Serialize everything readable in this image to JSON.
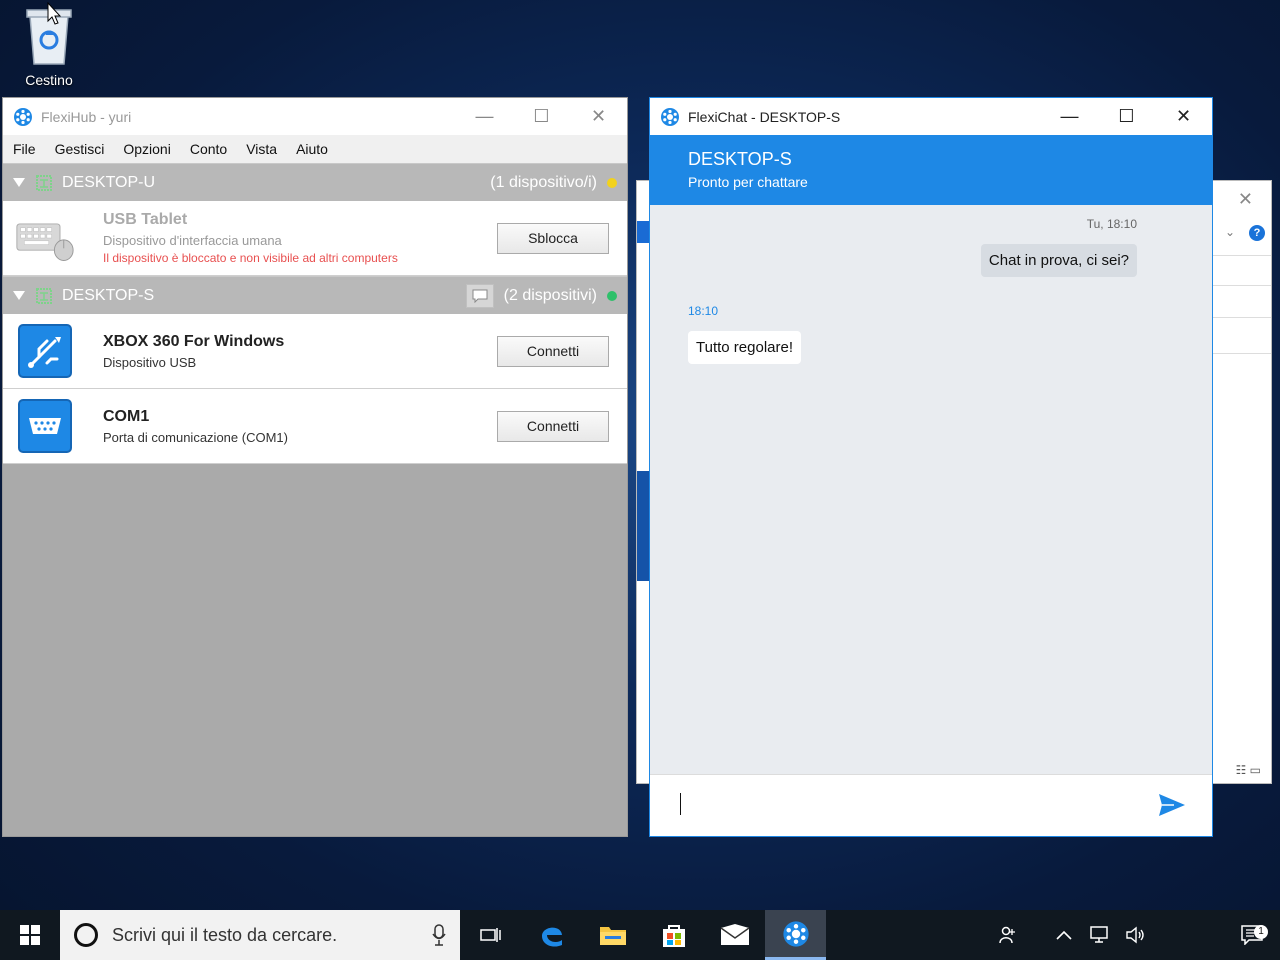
{
  "desktop": {
    "recycle_bin_label": "Cestino"
  },
  "flexihub": {
    "title": "FlexiHub - yuri",
    "menu": [
      "File",
      "Gestisci",
      "Opzioni",
      "Conto",
      "Vista",
      "Aiuto"
    ],
    "groups": [
      {
        "name": "DESKTOP-U",
        "count": "(1 dispositivo/i)",
        "status_color": "#f2d21c",
        "devices": [
          {
            "name": "USB Tablet",
            "type": "Dispositivo d'interfaccia umana",
            "warning": "Il dispositivo è bloccato e non visibile ad altri computers",
            "button": "Sblocca",
            "icon": "keyboard-mouse-icon"
          }
        ]
      },
      {
        "name": "DESKTOP-S",
        "count": "(2 dispositivi)",
        "status_color": "#2ec06a",
        "devices": [
          {
            "name": "XBOX 360 For Windows",
            "type": "Dispositivo USB",
            "button": "Connetti",
            "icon": "usb-icon"
          },
          {
            "name": "COM1",
            "type": "Porta di comunicazione (COM1)",
            "button": "Connetti",
            "icon": "serial-port-icon"
          }
        ]
      }
    ]
  },
  "flexichat": {
    "title": "FlexiChat - DESKTOP-S",
    "header_name": "DESKTOP-S",
    "header_status": "Pronto per chattare",
    "messages": [
      {
        "time": "Tu, 18:10",
        "text": "Chat in prova, ci sei?",
        "direction": "out"
      },
      {
        "time": "18:10",
        "text": "Tutto regolare!",
        "direction": "in"
      }
    ],
    "accent_color": "#1e88e5"
  },
  "taskbar": {
    "search_placeholder": "Scrivi qui il testo da cercare.",
    "notification_count": "1"
  }
}
